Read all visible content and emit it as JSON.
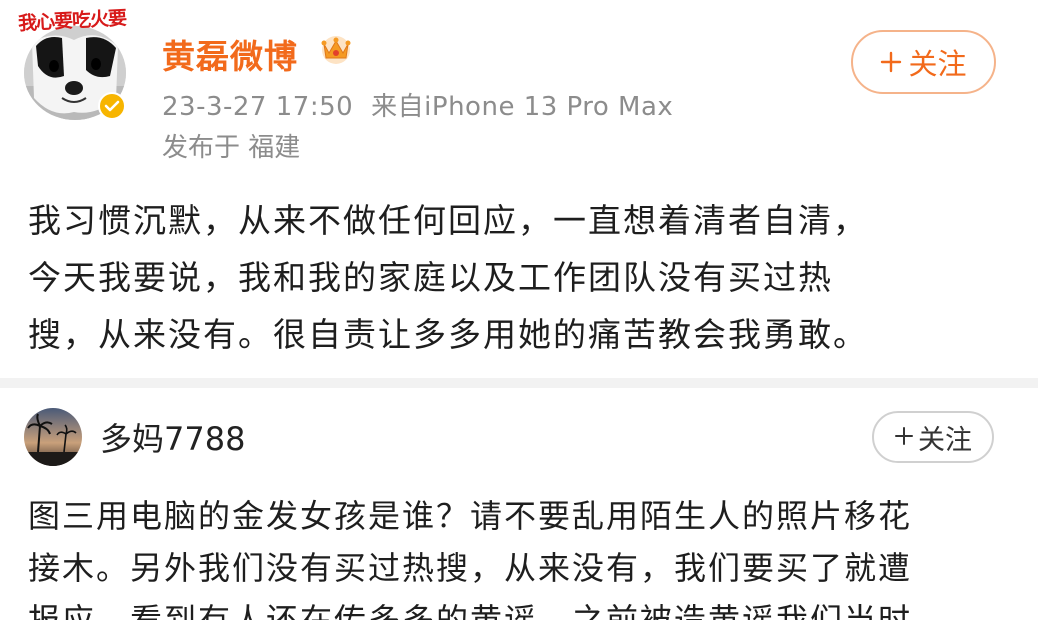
{
  "post": {
    "stamp_text": "我心要吃火要",
    "username": "黄磊微博",
    "timestamp": "23-3-27 17:50",
    "source": "来自iPhone 13 Pro Max",
    "location": "发布于 福建",
    "follow_label": "关注",
    "body_lines": [
      "我习惯沉默，从来不做任何回应，一直想着清者自清，",
      "今天我要说，我和我的家庭以及工作团队没有买过热",
      "搜，从来没有。很自责让多多用她的痛苦教会我勇敢。"
    ]
  },
  "comment": {
    "username": "多妈7788",
    "follow_label": "关注",
    "body_lines": [
      "图三用电脑的金发女孩是谁？请不要乱用陌生人的照片移花",
      "接木。另外我们没有买过热搜，从来没有，我们要买了就遭",
      "报应。看到有人还在传多多的黄谣，之前被造黄谣我们当时"
    ]
  },
  "colors": {
    "username_orange": "#f26a1b",
    "meta_gray": "#8c8c8c",
    "verified_gold": "#f7b500"
  }
}
